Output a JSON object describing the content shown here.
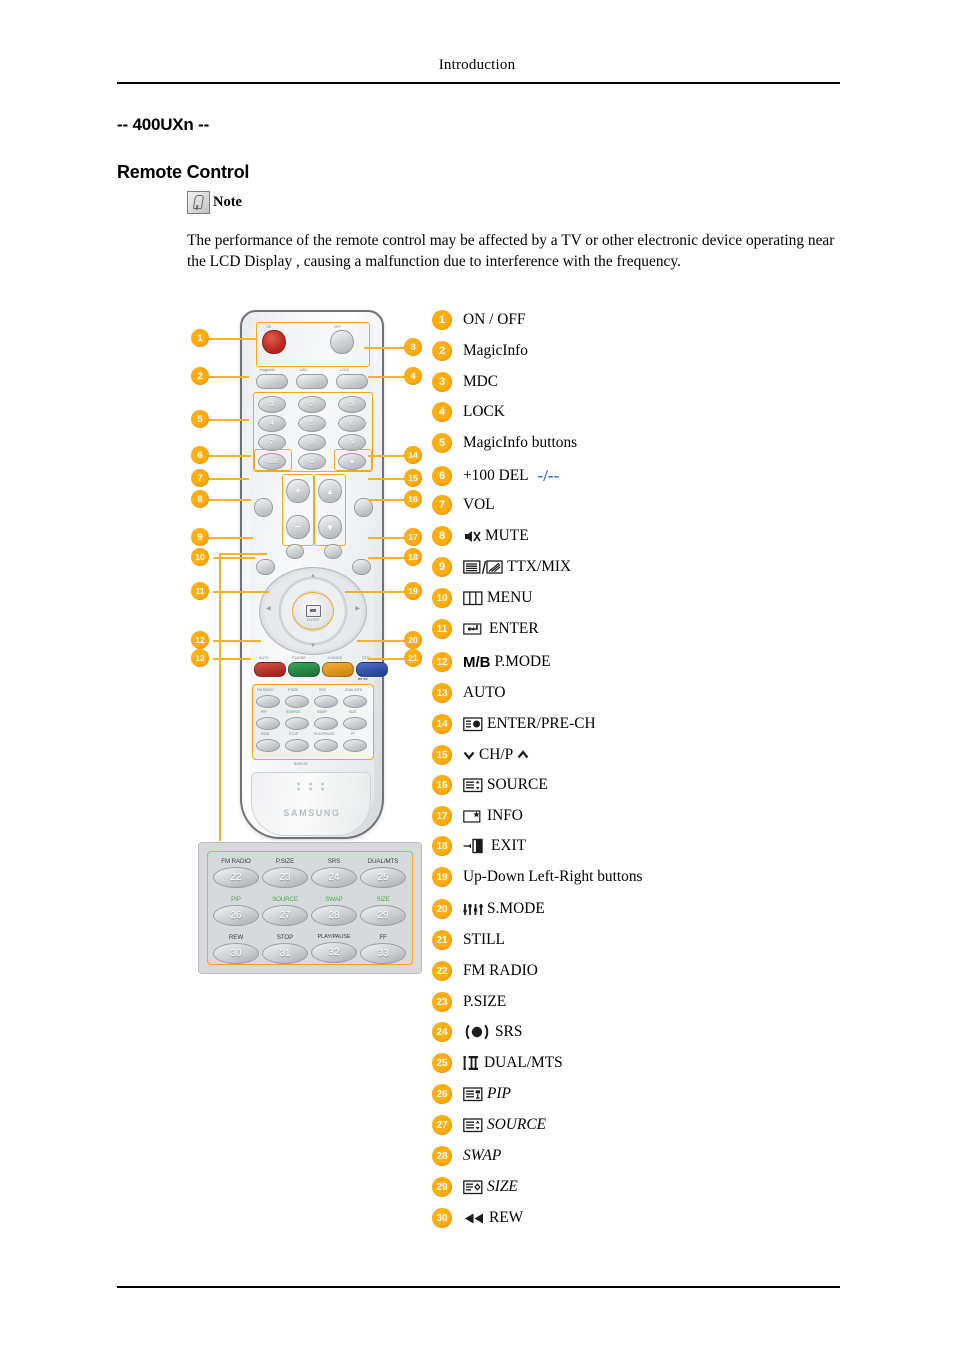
{
  "page": {
    "header": "Introduction",
    "model_heading": "-- 400UXn --",
    "section_heading": "Remote Control",
    "note_label": "Note",
    "note_body": "The performance of the remote control may be affected by a TV or other electronic device operating near the LCD Display , causing a malfunction due to interference with the frequency."
  },
  "colors": {
    "callout": "#FFAE10",
    "leader": "#F7B22B",
    "del_mark": "#3A66C8",
    "green_label": "#3FAA4A",
    "red_button": "#B3251A",
    "green_button": "#15702F",
    "orange_button": "#CF8208",
    "blue_button": "#1D3C90"
  },
  "legend": [
    {
      "n": "1",
      "label": "ON / OFF",
      "icon": null,
      "italic": false
    },
    {
      "n": "2",
      "label": "MagicInfo",
      "icon": null,
      "italic": false
    },
    {
      "n": "3",
      "label": "MDC",
      "icon": null,
      "italic": false
    },
    {
      "n": "4",
      "label": "LOCK",
      "icon": null,
      "italic": false
    },
    {
      "n": "5",
      "label": "MagicInfo buttons",
      "icon": null,
      "italic": false
    },
    {
      "n": "6",
      "label": "+100 DEL",
      "icon": "del-dash-icon",
      "italic": false,
      "suffix": "-/--"
    },
    {
      "n": "7",
      "label": "VOL",
      "icon": null,
      "italic": false
    },
    {
      "n": "8",
      "label": "MUTE",
      "icon": "mute-speaker-icon",
      "italic": false
    },
    {
      "n": "9",
      "label": "TTX/MIX",
      "icon": "ttx-mix-icon",
      "italic": false
    },
    {
      "n": "10",
      "label": "MENU",
      "icon": "menu-bars-icon",
      "italic": false
    },
    {
      "n": "11",
      "label": "ENTER",
      "icon": "enter-key-icon",
      "italic": false
    },
    {
      "n": "12",
      "label": "P.MODE",
      "icon": "mb-text-icon",
      "italic": false,
      "prefix": "M/B"
    },
    {
      "n": "13",
      "label": "AUTO",
      "icon": null,
      "italic": false
    },
    {
      "n": "14",
      "label": "ENTER/PRE-CH",
      "icon": "prech-box-icon",
      "italic": false
    },
    {
      "n": "15",
      "label": "CH/P",
      "icon": "chp-chevrons-icon",
      "italic": false
    },
    {
      "n": "16",
      "label": "SOURCE",
      "icon": "source-box-icon",
      "italic": false
    },
    {
      "n": "17",
      "label": "INFO",
      "icon": "info-box-icon",
      "italic": false
    },
    {
      "n": "18",
      "label": "EXIT",
      "icon": "exit-door-icon",
      "italic": false
    },
    {
      "n": "19",
      "label": "Up-Down Left-Right buttons",
      "icon": null,
      "italic": false
    },
    {
      "n": "20",
      "label": "S.MODE",
      "icon": "equalizer-icon",
      "italic": false
    },
    {
      "n": "21",
      "label": "STILL",
      "icon": null,
      "italic": false
    },
    {
      "n": "22",
      "label": "FM RADIO",
      "icon": null,
      "italic": false
    },
    {
      "n": "23",
      "label": "P.SIZE",
      "icon": null,
      "italic": false
    },
    {
      "n": "24",
      "label": "SRS",
      "icon": "srs-circle-icon",
      "italic": false
    },
    {
      "n": "25",
      "label": "DUAL/MTS",
      "icon": "dual-mts-icon",
      "italic": false
    },
    {
      "n": "26",
      "label": "PIP",
      "icon": "pip-box-icon",
      "italic": true
    },
    {
      "n": "27",
      "label": "SOURCE",
      "icon": "source-box-icon",
      "italic": true
    },
    {
      "n": "28",
      "label": "SWAP",
      "icon": null,
      "italic": true
    },
    {
      "n": "29",
      "label": "SIZE",
      "icon": "size-box-icon",
      "italic": true
    },
    {
      "n": "30",
      "label": "REW",
      "icon": "rew-arrows-icon",
      "italic": false
    }
  ],
  "remote": {
    "brand": "SAMSUNG",
    "top_labels": {
      "on": "ON",
      "off": "OFF"
    },
    "function_labels": {
      "magicinfo": "MagicInfo",
      "mdc": "MDC",
      "lock": "LOCK"
    },
    "keypad": [
      "1",
      "2",
      "3",
      "4",
      "5",
      "6",
      "7",
      "8",
      "9",
      "0"
    ],
    "plus100": "+100",
    "prech": "PRE-CH",
    "enter_label": "ENTER",
    "color_buttons": [
      {
        "label": "AUTO",
        "color": "red"
      },
      {
        "label": "P.MODE",
        "color": "green"
      },
      {
        "label": "S.MODE",
        "color": "orange"
      },
      {
        "label": "STILL",
        "color": "blue"
      }
    ],
    "callouts_left": [
      "1",
      "2",
      "5",
      "6",
      "7",
      "8",
      "9",
      "10",
      "11",
      "12",
      "13"
    ],
    "callouts_right": [
      "3",
      "4",
      "14",
      "15",
      "16",
      "17",
      "18",
      "19",
      "20",
      "21"
    ]
  },
  "detail_panel": {
    "rows": [
      {
        "labels": [
          "FM RADIO",
          "P.SIZE",
          "SRS",
          "DUAL/MTS"
        ],
        "keys": [
          "22",
          "23",
          "24",
          "25"
        ],
        "green": false
      },
      {
        "labels": [
          "PIP",
          "SOURCE",
          "SWAP",
          "SIZE"
        ],
        "keys": [
          "26",
          "27",
          "28",
          "29"
        ],
        "green": true
      },
      {
        "labels": [
          "REW",
          "STOP",
          "PLAY/PAUSE",
          "FF"
        ],
        "keys": [
          "30",
          "31",
          "32",
          "33"
        ],
        "green": false
      }
    ]
  }
}
